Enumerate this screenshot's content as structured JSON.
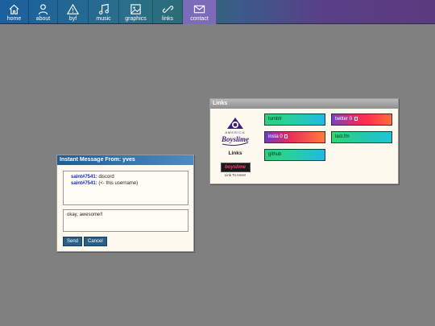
{
  "nav": {
    "items": [
      {
        "label": "home",
        "icon": "home-icon"
      },
      {
        "label": "about",
        "icon": "person-icon"
      },
      {
        "label": "byf",
        "icon": "warning-icon"
      },
      {
        "label": "music",
        "icon": "music-note-icon"
      },
      {
        "label": "graphics",
        "icon": "image-icon"
      },
      {
        "label": "links",
        "icon": "chain-link-icon"
      },
      {
        "label": "contact",
        "icon": "envelope-icon"
      }
    ],
    "active": "contact"
  },
  "links_window": {
    "title": "Links",
    "logo": {
      "line1": "AMERICA",
      "line2": "Boyslime"
    },
    "heading": "Links",
    "badge_text": "boyslime",
    "badge_caption": "Link To Here!",
    "links": [
      {
        "label": "tumblr",
        "marker": ""
      },
      {
        "label": "twitter",
        "marker": "0"
      },
      {
        "label": "insta",
        "marker": "0"
      },
      {
        "label": "last.fm",
        "marker": ""
      },
      {
        "label": "github",
        "marker": ""
      }
    ]
  },
  "im_window": {
    "title": "Instant Message From: yves",
    "messages": [
      {
        "sender": "saint#7541:",
        "text": "discord"
      },
      {
        "sender": "saint#7541:",
        "text": "(<- this username)"
      }
    ],
    "input_value": "okay, awesome!!",
    "send_label": "Send",
    "cancel_label": "Cancel"
  },
  "colors": {
    "desktop": "#808080",
    "im_title": "#1f5c8f",
    "nav_active": "#7b6bb8",
    "sender": "#1a2bb8"
  }
}
